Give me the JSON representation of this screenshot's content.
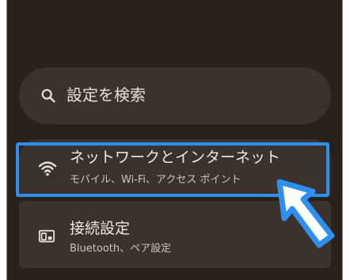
{
  "search": {
    "placeholder_text": "設定を検索",
    "icon": "search-icon"
  },
  "items": [
    {
      "title": "ネットワークとインターネット",
      "subtitle": "モバイル、Wi‑Fi、アクセス ポイント",
      "icon": "wifi-icon",
      "highlighted": true
    },
    {
      "title": "接続設定",
      "subtitle": "Bluetooth、ペア設定",
      "icon": "connected-devices-icon",
      "highlighted": false
    }
  ],
  "annotation": {
    "highlight_color": "#2f8ff0",
    "arrow_icon": "pointer-arrow-icon"
  },
  "colors": {
    "background": "#2a201c",
    "surface": "#3b322d"
  }
}
